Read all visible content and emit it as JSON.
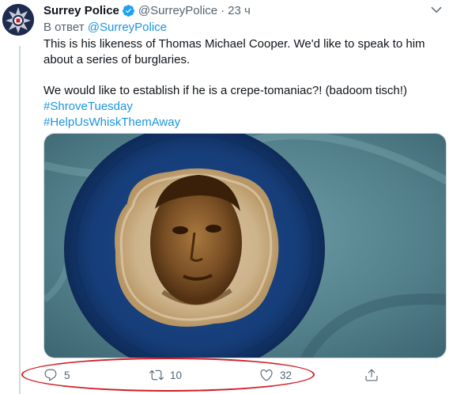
{
  "account": {
    "name": "Surrey Police",
    "handle": "@SurreyPolice",
    "time": "23 ч",
    "verified_color": "#1da1f2"
  },
  "reply": {
    "prefix": "В ответ",
    "mention": "@SurreyPolice"
  },
  "tweet": {
    "line1": "This is his likeness of Thomas Michael Cooper. We'd like to speak to him",
    "line2": "about a series of burglaries.",
    "line3": "We would like to establish if he is a crepe-tomaniac?! (badoom tisch!)",
    "hashtags": [
      "#ShroveTuesday",
      "#HelpUsWhiskThemAway"
    ]
  },
  "actions": {
    "replies": "5",
    "retweets": "10",
    "likes": "32"
  },
  "icons": {
    "avatar": "surrey-police-badge-icon",
    "verified": "verified-badge-icon",
    "caret": "chevron-down-icon",
    "reply": "reply-icon",
    "retweet": "retweet-icon",
    "like": "heart-icon",
    "share": "share-icon"
  },
  "colors": {
    "link": "#1b95e0",
    "muted": "#536471",
    "highlight_ring": "#d01e26"
  }
}
